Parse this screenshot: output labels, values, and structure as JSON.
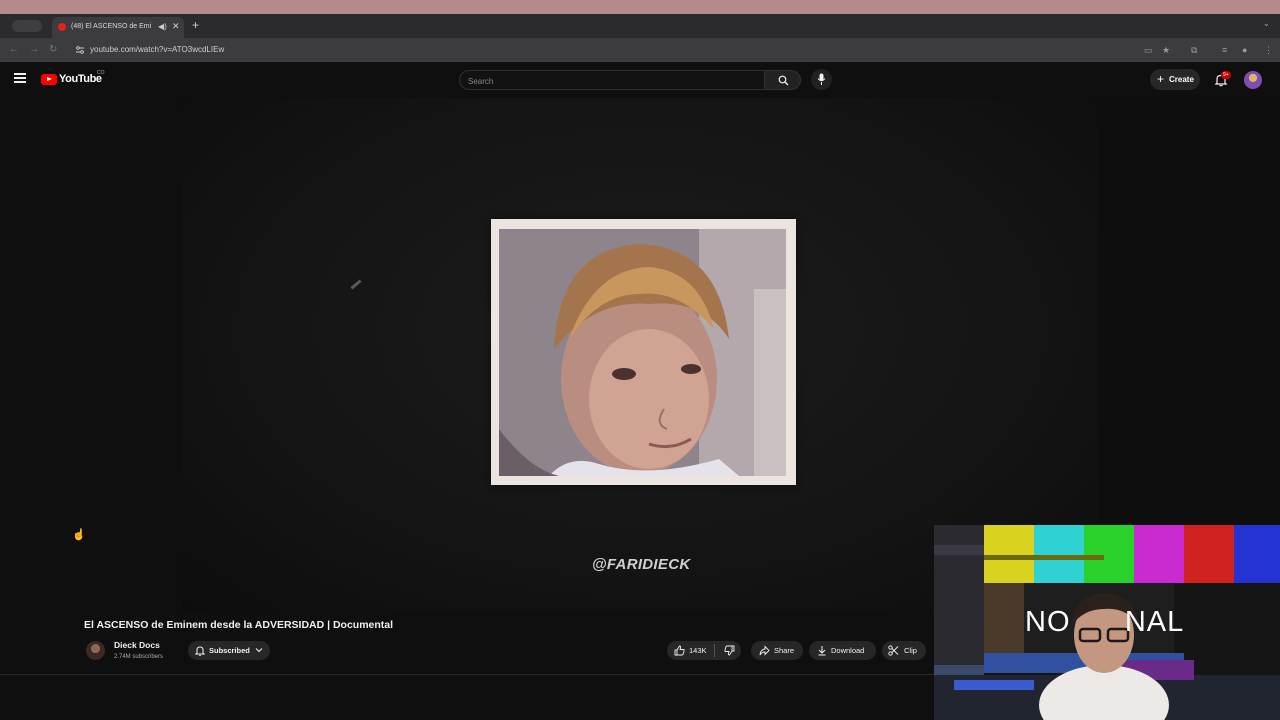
{
  "browser": {
    "tab_title": "(48) El ASCENSO de Emi",
    "url": "youtube.com/watch?v=ATO3wcdLIEw"
  },
  "youtube": {
    "logo_text": "YouTube",
    "country_code": "CO",
    "search_placeholder": "Search",
    "create_label": "Create",
    "notification_badge": "9+"
  },
  "video": {
    "watermark": "@FARIDIECK",
    "title": "El ASCENSO de Eminem desde la ADVERSIDAD | Documental",
    "channel_name": "Dieck Docs",
    "subscribers": "2.74M subscribers",
    "subscribe_label": "Subscribed",
    "likes": "143K",
    "share_label": "Share",
    "download_label": "Download",
    "clip_label": "Clip"
  },
  "webcam_overlay": {
    "text": "NO      NAL"
  },
  "colors": {
    "youtube_red": "#ff0000",
    "background": "#0f0f0f",
    "button_bg": "#272727",
    "tab_strip": "#2b2b2f",
    "mac_menubar": "#b58a8d"
  }
}
